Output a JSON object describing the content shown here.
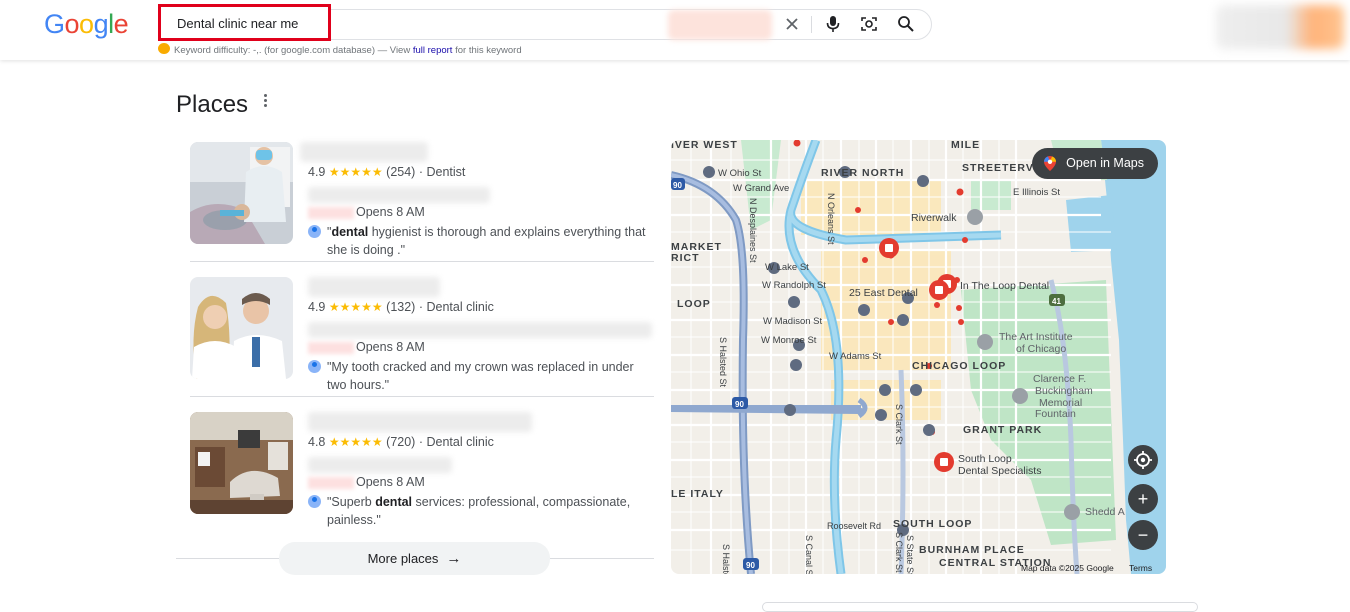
{
  "header": {
    "logo_letters": [
      {
        "ch": "G",
        "color": "#4285F4"
      },
      {
        "ch": "o",
        "color": "#EA4335"
      },
      {
        "ch": "o",
        "color": "#FBBC05"
      },
      {
        "ch": "g",
        "color": "#4285F4"
      },
      {
        "ch": "l",
        "color": "#34A853"
      },
      {
        "ch": "e",
        "color": "#EA4335"
      }
    ],
    "search_query": "Dental clinic near me",
    "keyword_line": {
      "prefix": "Keyword difficulty: -,. (for google.com database) — View ",
      "link": "full report",
      "suffix": " for this keyword"
    }
  },
  "places": {
    "title": "Places",
    "results": [
      {
        "rating": "4.9",
        "stars": "★★★★★",
        "reviews": "(254)",
        "category": "· Dentist",
        "opens": "Opens 8 AM",
        "review_bold": "dental",
        "review_pre": "\"",
        "review_post": " hygienist is thorough and explains everything that she is doing .\""
      },
      {
        "rating": "4.9",
        "stars": "★★★★★",
        "reviews": "(132)",
        "category": "· Dental clinic",
        "opens": "Opens 8 AM",
        "review_bold": "",
        "review_pre": "\"My tooth cracked and my crown was replaced in under two hours.\"",
        "review_post": ""
      },
      {
        "rating": "4.8",
        "stars": "★★★★★",
        "reviews": "(720)",
        "category": "· Dental clinic",
        "opens": "Opens 8 AM",
        "review_bold": "dental",
        "review_pre": "\"Superb ",
        "review_post": " services: professional, compassionate, painless.\""
      }
    ],
    "more_label": "More places"
  },
  "map": {
    "open_label": "Open in Maps",
    "credit": "Map data ©2025 Google",
    "terms": "Terms",
    "labels": {
      "river_west": "IVER WEST",
      "mile": "MILE",
      "streeterville": "STREETERV",
      "river_north": "RIVER NORTH",
      "w_ohio": "W Ohio St",
      "w_grand": "W Grand Ave",
      "e_illinois": "E Illinois St",
      "riverwalk": "Riverwalk",
      "market": "MARKET",
      "rict": "RICT",
      "w_lake": "W Lake St",
      "w_randolph": "W Randolph St",
      "loop_w": "LOOP",
      "east_dental": "25 East Dental",
      "in_the_loop": "In The Loop Dental",
      "w_madison": "W Madison St",
      "w_monroe": "W Monroe St",
      "art_institute_1": "The Art Institute",
      "art_institute_2": "of Chicago",
      "w_adams": "W Adams St",
      "chicago_loop": "CHICAGO LOOP",
      "buckingham_1": "Clarence F.",
      "buckingham_2": "Buckingham",
      "buckingham_3": "Memorial",
      "buckingham_4": "Fountain",
      "grant_park": "GRANT PARK",
      "south_loop_1": "South Loop",
      "south_loop_2": "Dental Specialists",
      "le_italy": "LE ITALY",
      "shedd": "Shedd A",
      "roosevelt": "Roosevelt Rd",
      "south_loop": "SOUTH LOOP",
      "burnham": "BURNHAM PLACE",
      "central_station": "CENTRAL STATION",
      "n_desplaines": "N Desplaines St",
      "s_halsted": "S Halsted St",
      "s_clark": "S Clark St",
      "n_orleans": "N Orleans St",
      "s_canal": "S Canal St",
      "s_state": "S State St",
      "s_halsted_2": "S Halsted St",
      "s_clark_2": "S Clark St",
      "i90_a": "90",
      "i90_b": "90",
      "i90_c": "90",
      "i41": "41"
    }
  }
}
